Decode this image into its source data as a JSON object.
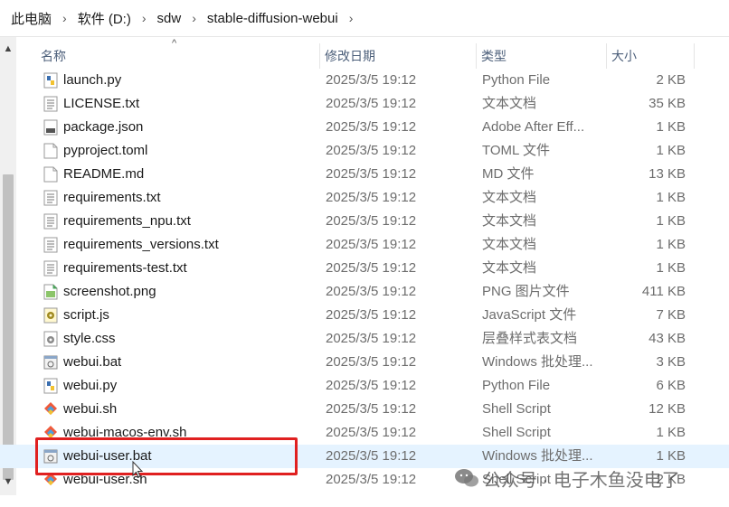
{
  "breadcrumb": [
    "此电脑",
    "软件 (D:)",
    "sdw",
    "stable-diffusion-webui"
  ],
  "columns": {
    "name": "名称",
    "date": "修改日期",
    "type": "类型",
    "size": "大小"
  },
  "files": [
    {
      "name": "launch.py",
      "date": "2025/3/5 19:12",
      "type": "Python File",
      "size": "2 KB",
      "icon": "python-file-icon"
    },
    {
      "name": "LICENSE.txt",
      "date": "2025/3/5 19:12",
      "type": "文本文档",
      "size": "35 KB",
      "icon": "text-file-icon"
    },
    {
      "name": "package.json",
      "date": "2025/3/5 19:12",
      "type": "Adobe After Eff...",
      "size": "1 KB",
      "icon": "json-file-icon"
    },
    {
      "name": "pyproject.toml",
      "date": "2025/3/5 19:12",
      "type": "TOML 文件",
      "size": "1 KB",
      "icon": "blank-file-icon"
    },
    {
      "name": "README.md",
      "date": "2025/3/5 19:12",
      "type": "MD 文件",
      "size": "13 KB",
      "icon": "blank-file-icon"
    },
    {
      "name": "requirements.txt",
      "date": "2025/3/5 19:12",
      "type": "文本文档",
      "size": "1 KB",
      "icon": "text-file-icon"
    },
    {
      "name": "requirements_npu.txt",
      "date": "2025/3/5 19:12",
      "type": "文本文档",
      "size": "1 KB",
      "icon": "text-file-icon"
    },
    {
      "name": "requirements_versions.txt",
      "date": "2025/3/5 19:12",
      "type": "文本文档",
      "size": "1 KB",
      "icon": "text-file-icon"
    },
    {
      "name": "requirements-test.txt",
      "date": "2025/3/5 19:12",
      "type": "文本文档",
      "size": "1 KB",
      "icon": "text-file-icon"
    },
    {
      "name": "screenshot.png",
      "date": "2025/3/5 19:12",
      "type": "PNG 图片文件",
      "size": "411 KB",
      "icon": "image-file-icon"
    },
    {
      "name": "script.js",
      "date": "2025/3/5 19:12",
      "type": "JavaScript 文件",
      "size": "7 KB",
      "icon": "script-file-icon"
    },
    {
      "name": "style.css",
      "date": "2025/3/5 19:12",
      "type": "层叠样式表文档",
      "size": "43 KB",
      "icon": "css-file-icon"
    },
    {
      "name": "webui.bat",
      "date": "2025/3/5 19:12",
      "type": "Windows 批处理...",
      "size": "3 KB",
      "icon": "batch-file-icon"
    },
    {
      "name": "webui.py",
      "date": "2025/3/5 19:12",
      "type": "Python File",
      "size": "6 KB",
      "icon": "python-file-icon"
    },
    {
      "name": "webui.sh",
      "date": "2025/3/5 19:12",
      "type": "Shell Script",
      "size": "12 KB",
      "icon": "shell-script-icon"
    },
    {
      "name": "webui-macos-env.sh",
      "date": "2025/3/5 19:12",
      "type": "Shell Script",
      "size": "1 KB",
      "icon": "shell-script-icon"
    },
    {
      "name": "webui-user.bat",
      "date": "2025/3/5 19:12",
      "type": "Windows 批处理...",
      "size": "1 KB",
      "icon": "batch-file-icon",
      "selected": true
    },
    {
      "name": "webui-user.sh",
      "date": "2025/3/5 19:12",
      "type": "Shell Script",
      "size": "2 KB",
      "icon": "shell-script-icon"
    }
  ],
  "watermark": {
    "text": "公众号 · 电子木鱼没电了"
  },
  "colors": {
    "highlight_box": "#e02020",
    "selected_row": "#e5f3ff",
    "header_text": "#4c5f7a"
  }
}
